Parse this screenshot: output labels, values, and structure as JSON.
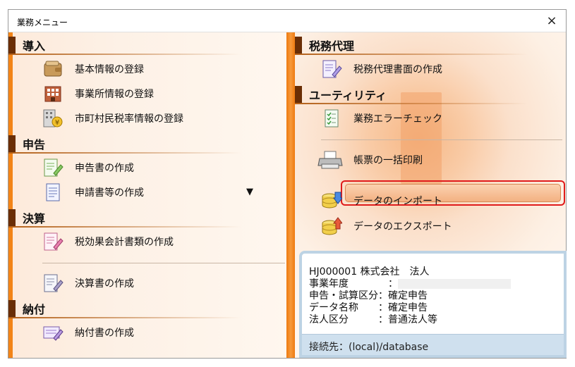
{
  "window": {
    "title": "業務メニュー",
    "close_glyph": "×"
  },
  "left": {
    "sections": [
      {
        "title": "導入",
        "items": [
          {
            "label": "基本情報の登録",
            "icon": "wallet-icon"
          },
          {
            "label": "事業所情報の登録",
            "icon": "office-building-icon"
          },
          {
            "label": "市町村民税率情報の登録",
            "icon": "city-tax-icon"
          }
        ]
      },
      {
        "title": "申告",
        "items": [
          {
            "label": "申告書の作成",
            "icon": "document-pen-icon"
          },
          {
            "label": "申請書等の作成",
            "icon": "document-icon",
            "dropdown": "▼"
          }
        ]
      },
      {
        "title": "決算",
        "items": [
          {
            "label": "税効果会計書類の作成",
            "icon": "pink-document-pen-icon"
          },
          {
            "label": "決算書の作成",
            "icon": "document-pen-icon"
          }
        ]
      },
      {
        "title": "納付",
        "items": [
          {
            "label": "納付書の作成",
            "icon": "payment-slip-icon"
          }
        ]
      }
    ]
  },
  "right": {
    "sections": [
      {
        "title": "税務代理",
        "items": [
          {
            "label": "税務代理書面の作成",
            "icon": "purple-document-pen-icon"
          }
        ]
      },
      {
        "title": "ユーティリティ",
        "items": [
          {
            "label": "業務エラーチェック",
            "icon": "checklist-icon"
          },
          {
            "label": "帳票の一括印刷",
            "icon": "printer-icon"
          },
          {
            "label": "データのインポート",
            "icon": "database-import-icon"
          },
          {
            "label": "データのエクスポート",
            "icon": "database-export-icon"
          }
        ]
      }
    ]
  },
  "info": {
    "rows": [
      "HJ000001 株式会社　法人",
      "事業年度　　　　：",
      "申告・試算区分：確定申告",
      "データ名称　　：確定申告",
      "法人区分　　　：普通法人等"
    ],
    "connection": "接続先：(local)/database"
  },
  "colors": {
    "accent": "#f28418",
    "section_mark": "#6a2e05",
    "highlight": "#e01b1b"
  }
}
